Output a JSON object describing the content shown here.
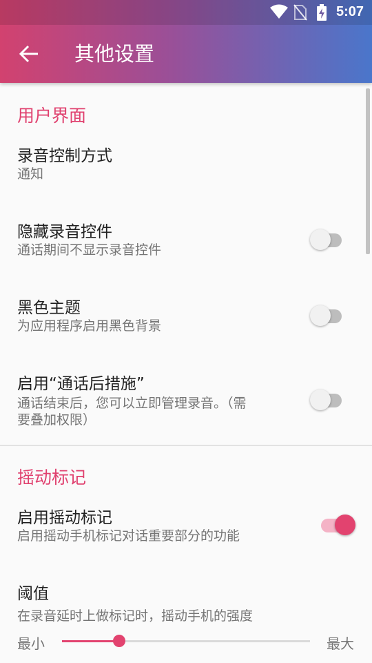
{
  "status_bar": {
    "time": "5:07",
    "icons": [
      "wifi-icon",
      "no-sim-icon",
      "battery-charging-icon"
    ]
  },
  "toolbar": {
    "back_icon": "arrow-left-icon",
    "title": "其他设置",
    "gradient": [
      "#d2426f",
      "#9b4f97",
      "#4a76cb"
    ]
  },
  "colors": {
    "accent": "#e2436f",
    "section_title": "#e0416f"
  },
  "sections": [
    {
      "title": "用户界面",
      "items": [
        {
          "title": "录音控制方式",
          "subtitle": "通知"
        },
        {
          "title": "隐藏录音控件",
          "subtitle": "通话期间不显示录音控件",
          "toggle": false
        },
        {
          "title": "黑色主题",
          "subtitle": "为应用程序启用黑色背景",
          "toggle": false
        },
        {
          "title": "启用“通话后措施”",
          "subtitle_line1": "通话结束后，您可以立即管理录音。（需",
          "subtitle_line2": "要叠加权限）",
          "toggle": false
        }
      ]
    },
    {
      "title": "摇动标记",
      "items": [
        {
          "title": "启用摇动标记",
          "subtitle": "启用摇动手机标记对话重要部分的功能",
          "toggle": true
        },
        {
          "title": "阈值",
          "subtitle": "在录音延时上做标记时，摇动手机的强度"
        }
      ]
    }
  ],
  "slider": {
    "min_label": "最小",
    "max_label": "最大",
    "value_fraction": 0.23
  }
}
